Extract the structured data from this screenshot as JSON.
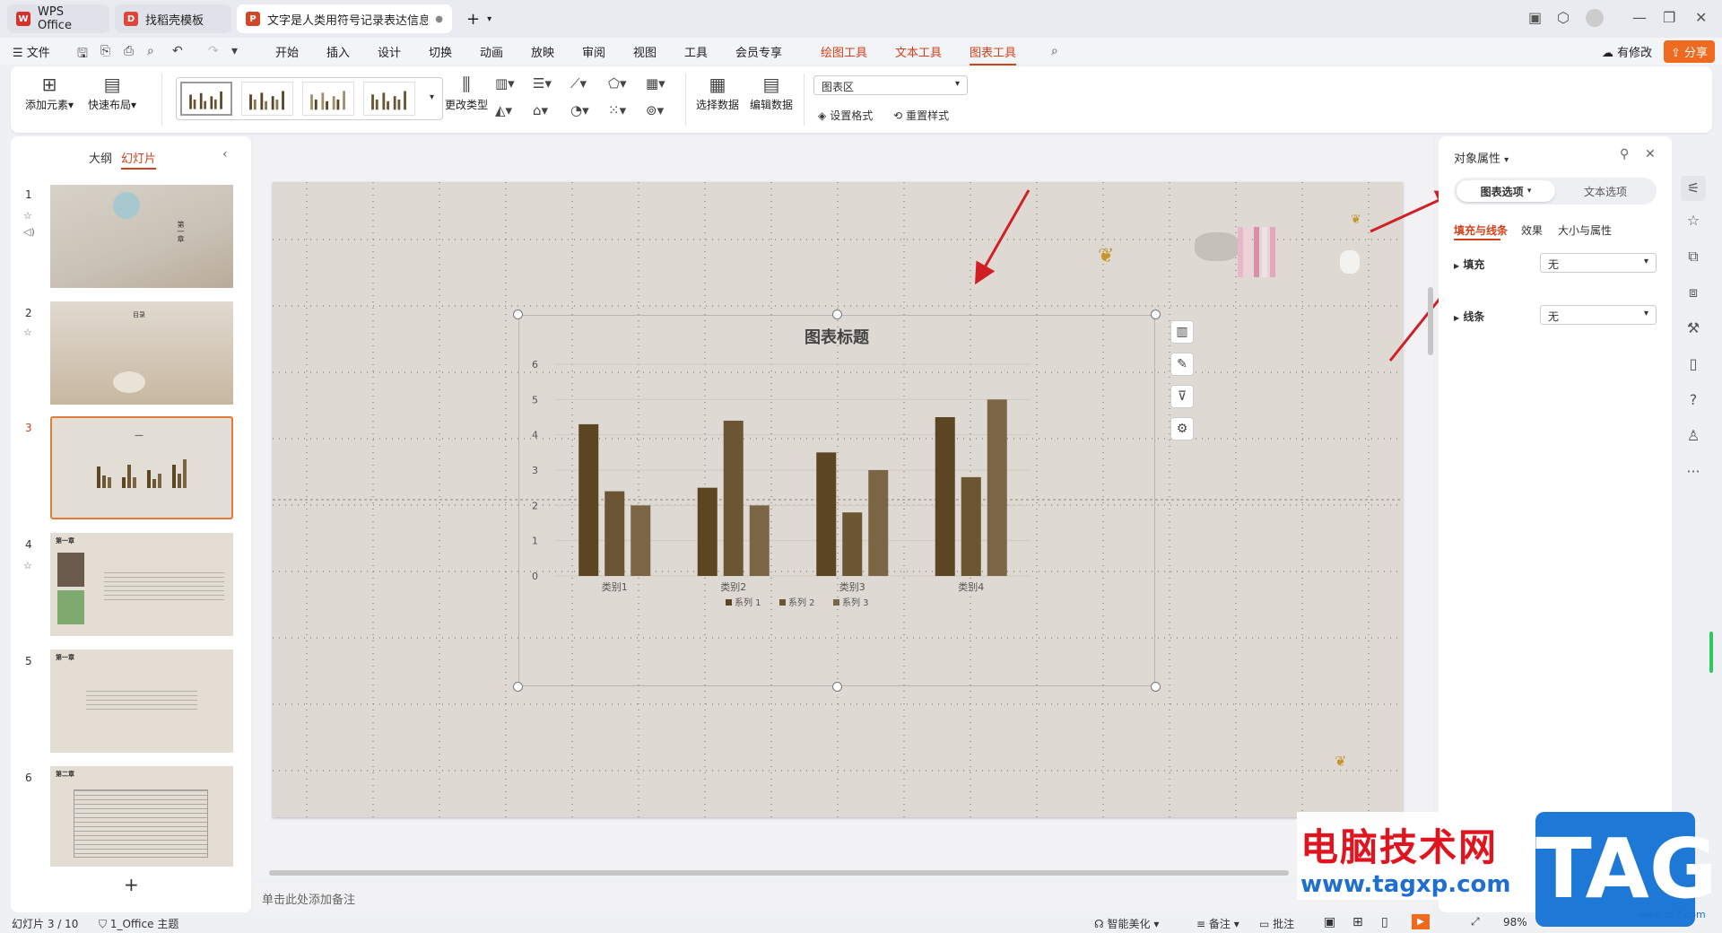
{
  "titlebar": {
    "tabs": [
      {
        "label": "WPS Office",
        "icon": "wps-logo-icon"
      },
      {
        "label": "找稻壳模板",
        "icon": "docer-logo-icon"
      },
      {
        "label": "文字是人类用符号记录表达信息以",
        "icon": "ppt-file-icon"
      }
    ],
    "new_tab": "+"
  },
  "menubar": {
    "file": "文件",
    "items": [
      "开始",
      "插入",
      "设计",
      "切换",
      "动画",
      "放映",
      "审阅",
      "视图",
      "工具",
      "会员专享"
    ],
    "context_tabs": [
      "绘图工具",
      "文本工具",
      "图表工具"
    ],
    "active_tab": "图表工具",
    "modified": "有修改",
    "share": "分享"
  },
  "ribbon": {
    "add_element": "添加元素",
    "quick_layout": "快速布局",
    "change_type": "更改类型",
    "select_data": "选择数据",
    "edit_data": "编辑数据",
    "area_combo": "图表区",
    "set_format": "设置格式",
    "reset_style": "重置样式"
  },
  "left_panel": {
    "tab_outline": "大纲",
    "tab_slides": "幻灯片",
    "slides": [
      "1",
      "2",
      "3",
      "4",
      "5",
      "6"
    ],
    "add_slide": "+",
    "slide4_title": "第一章",
    "slide5_title": "第一章",
    "slide6_title": "第二章",
    "slide1_text": "第一章",
    "slide2_title": "目录",
    "slide3_title": "—"
  },
  "chart_data": {
    "type": "bar",
    "title": "图表标题",
    "categories": [
      "类别1",
      "类别2",
      "类别3",
      "类别4"
    ],
    "series": [
      {
        "name": "系列 1",
        "values": [
          4.3,
          2.5,
          3.5,
          4.5
        ],
        "color": "#5c4523"
      },
      {
        "name": "系列 2",
        "values": [
          2.4,
          4.4,
          1.8,
          2.8
        ],
        "color": "#6b5532"
      },
      {
        "name": "系列 3",
        "values": [
          2.0,
          2.0,
          3.0,
          5.0
        ],
        "color": "#7a6545"
      }
    ],
    "y_ticks": [
      "0",
      "1",
      "2",
      "3",
      "4",
      "5",
      "6"
    ],
    "ylim": [
      0,
      6
    ],
    "legend": "bottom",
    "grid": true
  },
  "notes_placeholder": "单击此处添加备注",
  "right_panel": {
    "title": "对象属性",
    "tab_chart_options": "图表选项",
    "tab_text_options": "文本选项",
    "sub_fill_line": "填充与线条",
    "sub_effect": "效果",
    "sub_size": "大小与属性",
    "fill_label": "填充",
    "fill_value": "无",
    "line_label": "线条",
    "line_value": "无"
  },
  "statusbar": {
    "slide_info": "幻灯片 3 / 10",
    "theme": "1_Office 主题",
    "smart_beautify": "智能美化",
    "notes": "备注",
    "comments": "批注",
    "zoom": "98%"
  },
  "watermark": {
    "site_name": "电脑技术网",
    "url": "www.tagxp.com",
    "logo": "TAG",
    "small_url": "www.xz7.com"
  },
  "colors": {
    "accent": "#d0421b",
    "bar_dark": "#5c4523",
    "slide_bg": "#dedad3",
    "arrow": "#d11f26"
  }
}
